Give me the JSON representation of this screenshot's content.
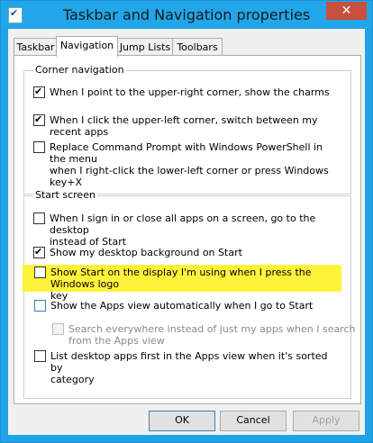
{
  "window": {
    "title": "Taskbar and Navigation properties",
    "close_label": "✕"
  },
  "tabs": [
    {
      "label": "Taskbar"
    },
    {
      "label": "Navigation"
    },
    {
      "label": "Jump Lists"
    },
    {
      "label": "Toolbars"
    }
  ],
  "corner": {
    "title": "Corner navigation",
    "items": [
      {
        "label": "When I point to the upper-right corner, show the charms",
        "checked": true
      },
      {
        "label": "When I click the upper-left corner, switch between my recent apps",
        "checked": true
      },
      {
        "label_line1": "Replace Command Prompt with Windows PowerShell in the menu",
        "label_line2": "when I right-click the lower-left corner or press Windows key+X",
        "checked": false
      }
    ]
  },
  "start": {
    "title": "Start screen",
    "items": [
      {
        "label_line1": "When I sign in or close all apps on a screen, go to the desktop",
        "label_line2": "instead of Start",
        "checked": false
      },
      {
        "label": "Show my desktop background on Start",
        "checked": true
      },
      {
        "label_line1": "Show Start on the display I'm using when I press the Windows logo",
        "label_line2": "key",
        "checked": false
      },
      {
        "label": "Show the Apps view automatically when I go to Start",
        "checked": false
      },
      {
        "label_line1": "Search everywhere instead of just my apps when I search",
        "label_line2": "from the Apps view",
        "checked": false,
        "disabled": true
      },
      {
        "label_line1": "List desktop apps first in the Apps view when it's sorted by",
        "label_line2": "category",
        "checked": false
      }
    ]
  },
  "buttons": {
    "ok": "OK",
    "cancel": "Cancel",
    "apply": "Apply"
  }
}
